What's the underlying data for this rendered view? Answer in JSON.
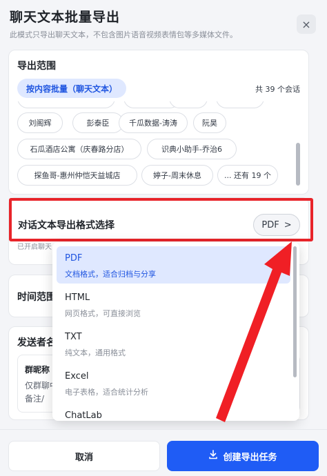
{
  "header": {
    "title": "聊天文本批量导出",
    "subtitle": "此模式只导出聊天文本，不包含图片语音视频表情包等多媒体文件。",
    "close_icon": "×"
  },
  "scope": {
    "title": "导出范围",
    "tab_label": "按内容批量（聊天文本）",
    "count_label": "共 39 个会话",
    "chips": [
      "刘阁辉",
      "彭泰臣",
      "千瓜数据-涛涛",
      "阮昊",
      "石瓜酒店公寓（庆春路分店）",
      "识典小助手-乔治6",
      "探鱼哥-惠州仲恺天益城店",
      "婷子-周末休息",
      "... 还有 19 个"
    ]
  },
  "format": {
    "title": "对话文本导出格式选择",
    "selected": "PDF",
    "chevron": ">",
    "hint": "已开启聊天"
  },
  "time": {
    "title": "时间范围"
  },
  "sender": {
    "title": "发送者名",
    "box_title": "群昵称",
    "box_desc": "仅群聊中示备注/"
  },
  "dropdown": {
    "options": [
      {
        "label": "PDF",
        "desc": "文档格式，适合归档与分享"
      },
      {
        "label": "HTML",
        "desc": "网页格式，可直接浏览"
      },
      {
        "label": "TXT",
        "desc": "纯文本，通用格式"
      },
      {
        "label": "Excel",
        "desc": "电子表格，适合统计分析"
      },
      {
        "label": "ChatLab",
        "desc": ""
      }
    ]
  },
  "footer": {
    "cancel_label": "取消",
    "create_label": "创建导出任务",
    "create_icon": "download-icon"
  },
  "colors": {
    "accent": "#1f5cf5",
    "highlight": "#e8242a",
    "selected_bg": "#dfe8ff"
  }
}
